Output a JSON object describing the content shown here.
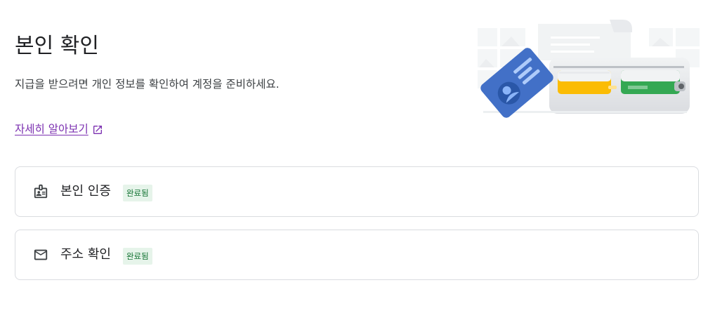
{
  "header": {
    "title": "본인 확인",
    "description": "지급을 받으려면 개인 정보를 확인하여 계정을 준비하세요.",
    "learn_more_label": "자세히 알아보기"
  },
  "icons": {
    "learn_more": "open-in-new-icon",
    "identity": "badge-id-icon",
    "address": "mail-icon"
  },
  "colors": {
    "link": "#7b2fb0",
    "badge_bg": "#e6f4ea",
    "badge_text": "#137333",
    "card_border": "#dadce0"
  },
  "steps": [
    {
      "label": "본인 인증",
      "status": "완료됨"
    },
    {
      "label": "주소 확인",
      "status": "완료됨"
    }
  ]
}
